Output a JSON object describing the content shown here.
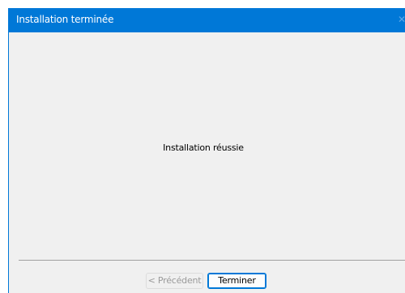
{
  "window": {
    "title": "Installation terminée",
    "accent_color": "#0078d7",
    "close_icon": "close-icon"
  },
  "main": {
    "message": "Installation réussie"
  },
  "footer": {
    "previous_label": "< Précédent",
    "previous_enabled": false,
    "finish_label": "Terminer",
    "finish_is_default": true
  }
}
